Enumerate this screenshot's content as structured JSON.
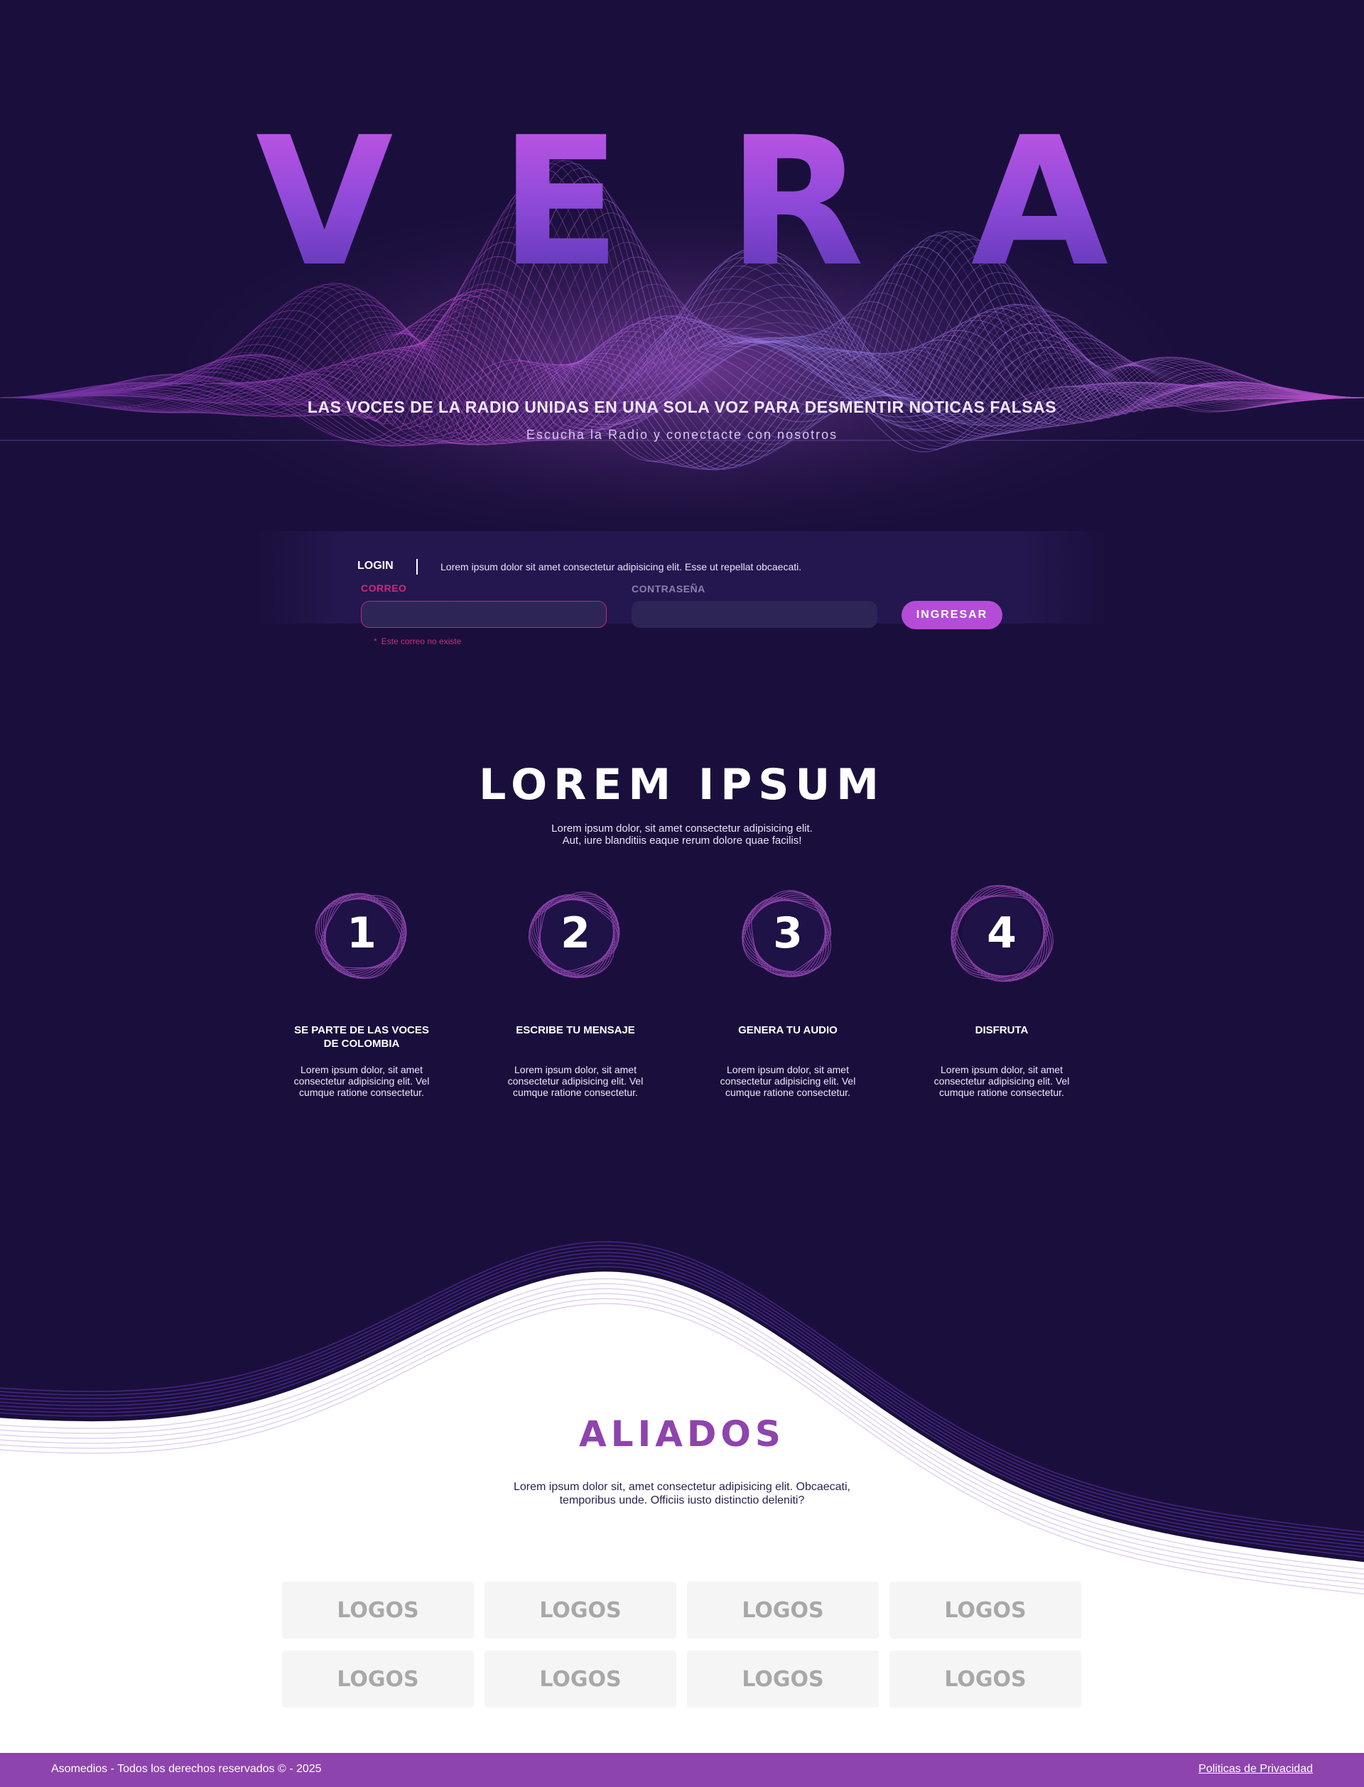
{
  "hero": {
    "brand": "VERA",
    "title": "LAS VOCES DE LA RADIO UNIDAS EN UNA SOLA VOZ PARA DESMENTIR NOTICAS FALSAS",
    "subtitle": "Escucha la Radio y conectacte con nosotros"
  },
  "login": {
    "label": "LOGIN",
    "description": "Lorem ipsum dolor sit amet consectetur adipisicing elit. Esse ut repellat obcaecati.",
    "email_label": "CORREO",
    "email_value": "",
    "password_label": "CONTRASEÑA",
    "password_value": "",
    "button": "INGRESAR",
    "error_star": "*",
    "error": "Este correo no existe"
  },
  "steps_section": {
    "title": "LOREM IPSUM",
    "desc_line1": "Lorem ipsum dolor, sit amet consectetur adipisicing elit.",
    "desc_line2": "Aut, iure blanditiis eaque rerum dolore quae facilis!",
    "steps": [
      {
        "number": "1",
        "title_line1": "SE PARTE DE LAS VOCES",
        "title_line2": "DE COLOMBIA",
        "text": "Lorem ipsum dolor, sit amet consectetur adipisicing elit. Vel cumque ratione consectetur."
      },
      {
        "number": "2",
        "title_line1": "ESCRIBE TU MENSAJE",
        "title_line2": "",
        "text": "Lorem ipsum dolor, sit amet consectetur adipisicing elit. Vel cumque ratione consectetur."
      },
      {
        "number": "3",
        "title_line1": "GENERA TU AUDIO",
        "title_line2": "",
        "text": "Lorem ipsum dolor, sit amet consectetur adipisicing elit. Vel cumque ratione consectetur."
      },
      {
        "number": "4",
        "title_line1": "DISFRUTA",
        "title_line2": "",
        "text": "Lorem ipsum dolor, sit amet consectetur adipisicing elit. Vel cumque ratione consectetur."
      }
    ]
  },
  "aliados": {
    "title": "ALIADOS",
    "desc_line1": "Lorem ipsum dolor sit, amet consectetur adipisicing elit. Obcaecati,",
    "desc_line2": "temporibus unde. Officiis iusto distinctio deleniti?",
    "logos": [
      "LOGOS",
      "LOGOS",
      "LOGOS",
      "LOGOS",
      "LOGOS",
      "LOGOS",
      "LOGOS",
      "LOGOS"
    ]
  },
  "footer": {
    "copyright": "Asomedios - Todos los derechos reservados ©  -  2025",
    "privacy_link": "Politicas de Privacidad"
  },
  "colors": {
    "background": "#1a0f3c",
    "accent_purple": "#8e44ad",
    "button": "#b44cd8",
    "error": "#d1287d"
  }
}
